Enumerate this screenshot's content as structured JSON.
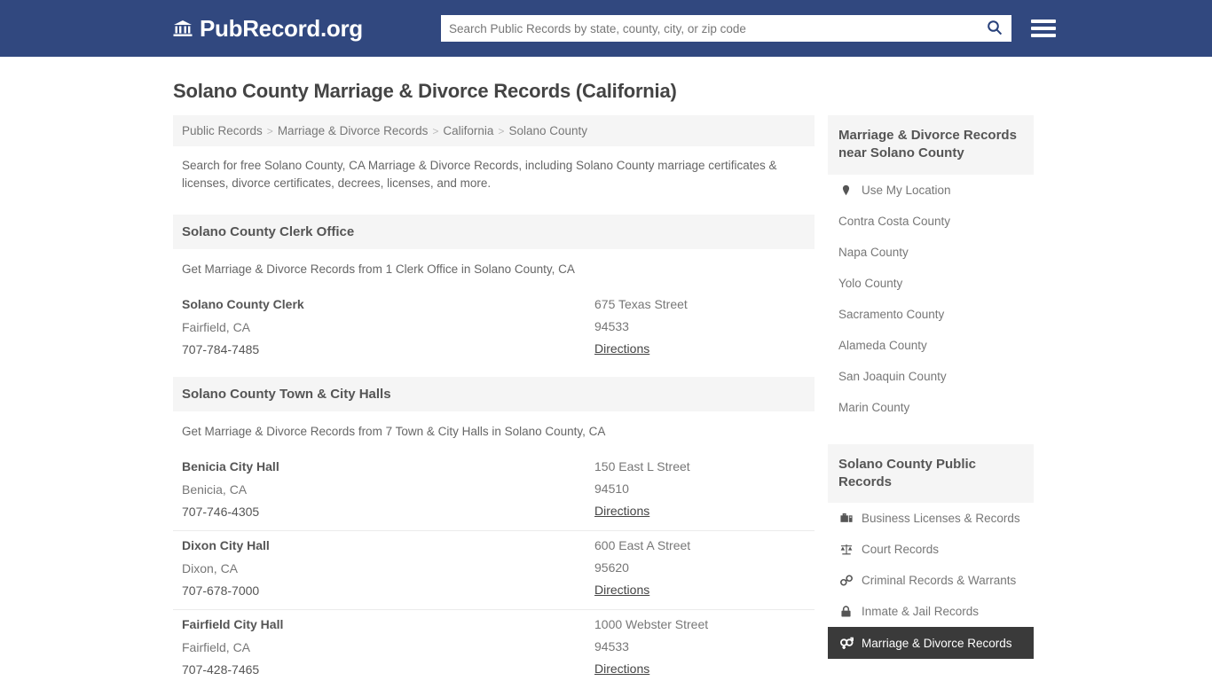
{
  "header": {
    "brand_name": "PubRecord.org",
    "brand_icon": "bank-icon",
    "search_placeholder": "Search Public Records by state, county, city, or zip code",
    "search_value": "",
    "search_icon": "search-icon",
    "menu_icon": "hamburger-menu-icon"
  },
  "page": {
    "title": "Solano County Marriage & Divorce Records (California)",
    "intro": "Search for free Solano County, CA Marriage & Divorce Records, including Solano County marriage certificates & licenses, divorce certificates, decrees, licenses, and more."
  },
  "breadcrumb": {
    "separator": ">",
    "items": [
      {
        "label": "Public Records"
      },
      {
        "label": "Marriage & Divorce Records"
      },
      {
        "label": "California"
      },
      {
        "label": "Solano County"
      }
    ]
  },
  "sections": [
    {
      "heading": "Solano County Clerk Office",
      "subtitle": "Get Marriage & Divorce Records from 1 Clerk Office in Solano County, CA",
      "records": [
        {
          "name": "Solano County Clerk",
          "city_state": "Fairfield, CA",
          "phone": "707-784-7485",
          "address": "675 Texas Street",
          "zip": "94533",
          "directions_label": "Directions"
        }
      ]
    },
    {
      "heading": "Solano County Town & City Halls",
      "subtitle": "Get Marriage & Divorce Records from 7 Town & City Halls in Solano County, CA",
      "records": [
        {
          "name": "Benicia City Hall",
          "city_state": "Benicia, CA",
          "phone": "707-746-4305",
          "address": "150 East L Street",
          "zip": "94510",
          "directions_label": "Directions"
        },
        {
          "name": "Dixon City Hall",
          "city_state": "Dixon, CA",
          "phone": "707-678-7000",
          "address": "600 East A Street",
          "zip": "95620",
          "directions_label": "Directions"
        },
        {
          "name": "Fairfield City Hall",
          "city_state": "Fairfield, CA",
          "phone": "707-428-7465",
          "address": "1000 Webster Street",
          "zip": "94533",
          "directions_label": "Directions"
        }
      ]
    }
  ],
  "sidebar": {
    "nearby": {
      "heading": "Marriage & Divorce Records near Solano County",
      "items": [
        {
          "label": "Use My Location",
          "icon": "map-pin-icon",
          "active": false
        },
        {
          "label": "Contra Costa County",
          "icon": "",
          "active": false
        },
        {
          "label": "Napa County",
          "icon": "",
          "active": false
        },
        {
          "label": "Yolo County",
          "icon": "",
          "active": false
        },
        {
          "label": "Sacramento County",
          "icon": "",
          "active": false
        },
        {
          "label": "Alameda County",
          "icon": "",
          "active": false
        },
        {
          "label": "San Joaquin County",
          "icon": "",
          "active": false
        },
        {
          "label": "Marin County",
          "icon": "",
          "active": false
        }
      ]
    },
    "public_records": {
      "heading": "Solano County Public Records",
      "items": [
        {
          "label": "Business Licenses & Records",
          "icon": "briefcase-icon",
          "active": false
        },
        {
          "label": "Court Records",
          "icon": "balance-scale-icon",
          "active": false
        },
        {
          "label": "Criminal Records & Warrants",
          "icon": "handcuffs-icon",
          "active": false
        },
        {
          "label": "Inmate & Jail Records",
          "icon": "lock-icon",
          "active": false
        },
        {
          "label": "Marriage & Divorce Records",
          "icon": "venus-mars-icon",
          "active": true
        }
      ]
    }
  },
  "colors": {
    "header_bg": "#31487f",
    "panel_bg": "#f5f5f5",
    "active_bg": "#3a3a3a",
    "text": "#555555",
    "muted": "#777777"
  }
}
